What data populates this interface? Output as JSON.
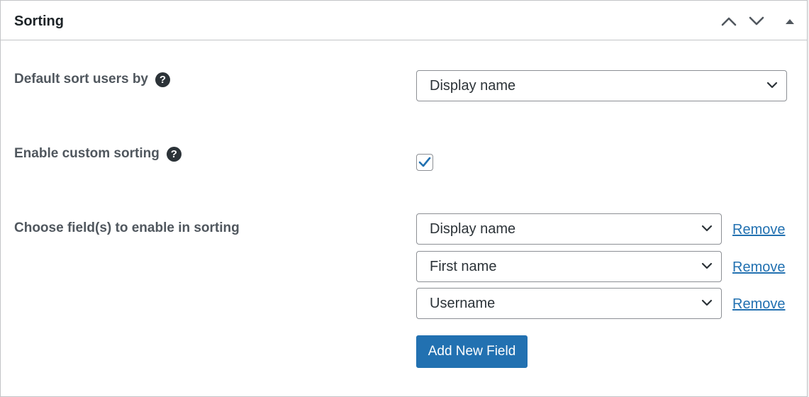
{
  "panel": {
    "title": "Sorting",
    "header_icons": [
      "chevron-up-icon",
      "chevron-down-icon",
      "triangle-up-icon"
    ]
  },
  "default_sort": {
    "label": "Default sort users by",
    "help_icon": "?",
    "selected": "Display name"
  },
  "custom_sorting": {
    "label": "Enable custom sorting",
    "help_icon": "?",
    "checked": true
  },
  "sort_fields": {
    "label": "Choose field(s) to enable in sorting",
    "fields": [
      {
        "selected": "Display name",
        "remove_label": "Remove"
      },
      {
        "selected": "First name",
        "remove_label": "Remove"
      },
      {
        "selected": "Username",
        "remove_label": "Remove"
      }
    ],
    "add_button_label": "Add New Field"
  },
  "colors": {
    "accent": "#2271b1",
    "border": "#c3c4c7",
    "label_text": "#50575e"
  }
}
